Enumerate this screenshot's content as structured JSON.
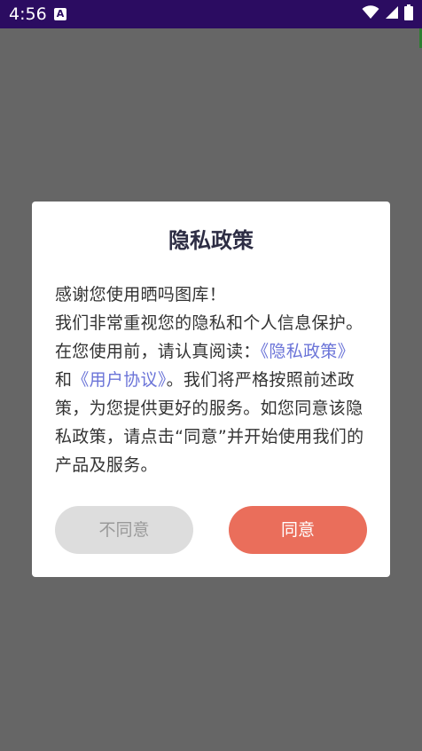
{
  "status_bar": {
    "time": "4:56",
    "a_icon_label": "A",
    "bg_color": "#2b0c61"
  },
  "dialog": {
    "title": "隐私政策",
    "body": {
      "line1": "感谢您使用晒吗图库！",
      "para_before_link1": "我们非常重视您的隐私和个人信息保护。在您使用前，请认真阅读：",
      "link_privacy": "《隐私政策》",
      "between_links": "和",
      "link_terms": "《用户协议》",
      "para_after_links": "。我们将严格按照前述政策，为您提供更好的服务。如您同意该隐私政策，请点击“同意”并开始使用我们的产品及服务。"
    },
    "buttons": {
      "decline_label": "不同意",
      "agree_label": "同意"
    }
  },
  "colors": {
    "overlay_bg": "#666666",
    "link": "#6b74d8",
    "agree_button": "#ea6e5b",
    "decline_button": "#dddddd"
  }
}
